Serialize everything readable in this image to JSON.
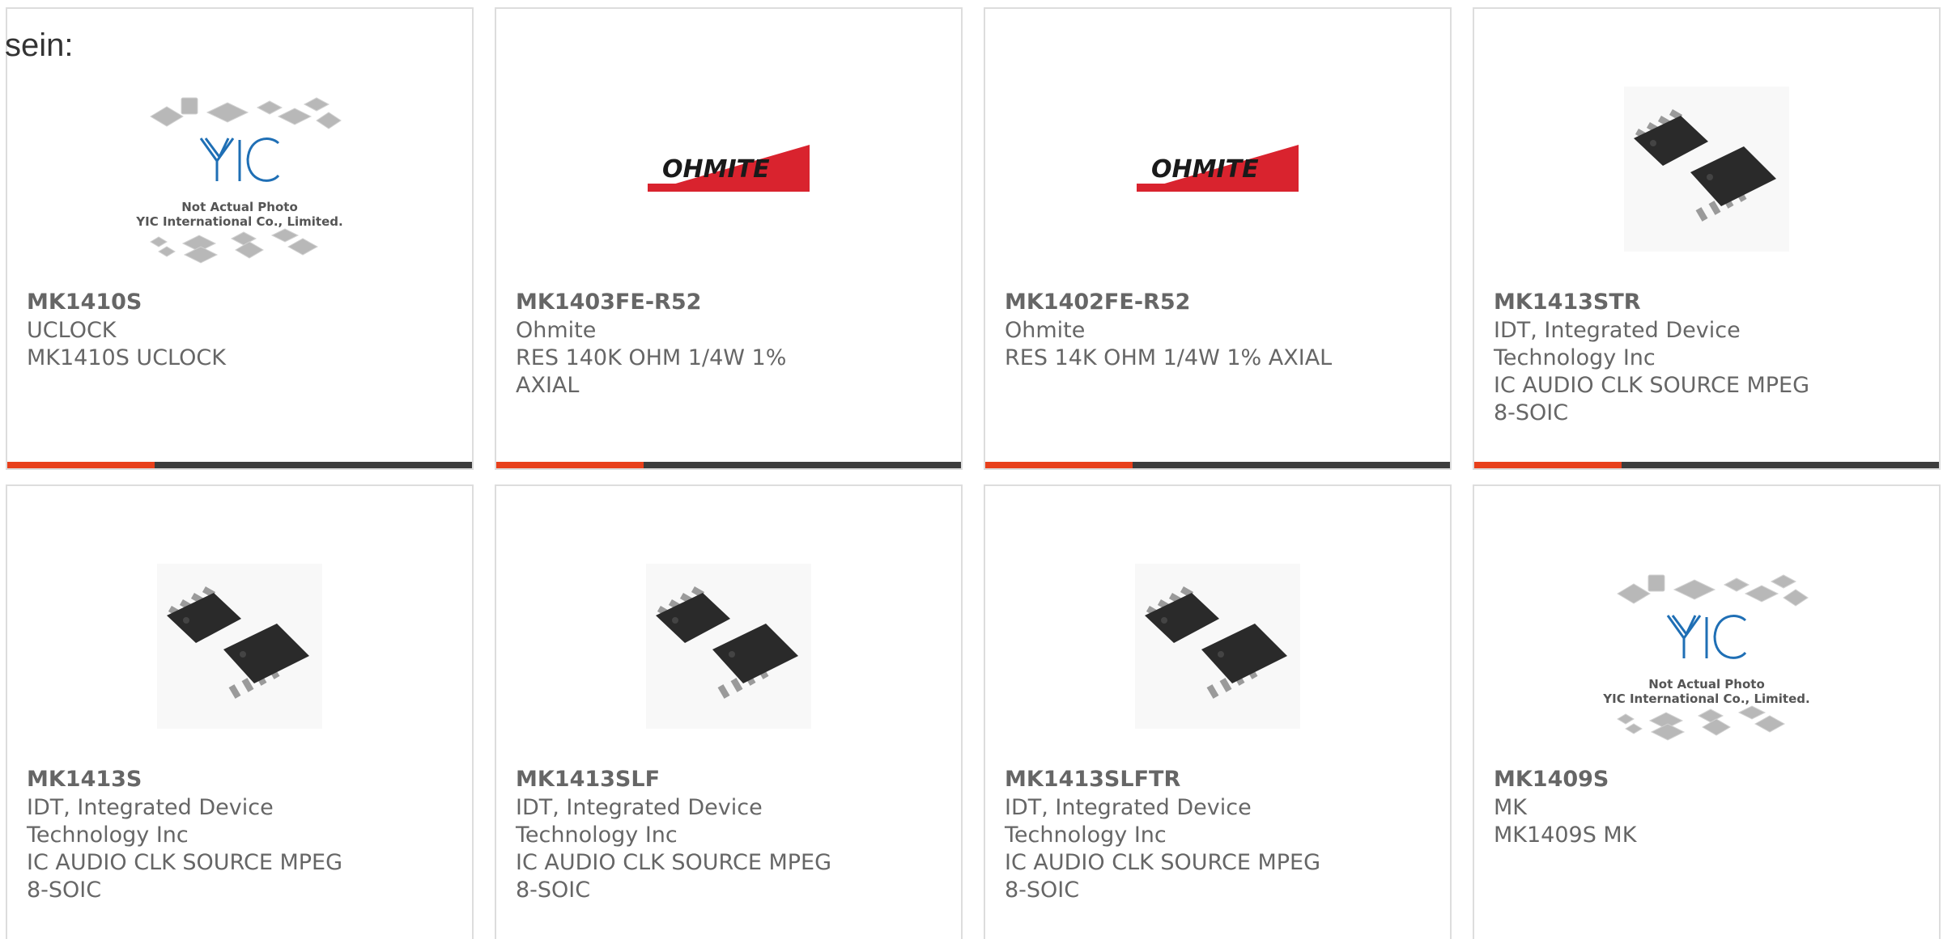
{
  "lead_text": "sein:",
  "cards": [
    {
      "part": "MK1410S",
      "maker": "UCLOCK",
      "description": "MK1410S UCLOCK",
      "image": "yic-placeholder",
      "placeholder_caption_1": "Not Actual Photo",
      "placeholder_caption_2": "YIC International Co., Limited.",
      "logo_text": "YIC"
    },
    {
      "part": "MK1403FE-R52",
      "maker": "Ohmite",
      "description": "RES 140K OHM 1/4W 1% AXIAL",
      "image": "ohmite-logo",
      "logo_text": "OHMITE"
    },
    {
      "part": "MK1402FE-R52",
      "maker": "Ohmite",
      "description": "RES 14K OHM 1/4W 1% AXIAL",
      "image": "ohmite-logo",
      "logo_text": "OHMITE"
    },
    {
      "part": "MK1413STR",
      "maker": "IDT, Integrated Device Technology Inc",
      "description": "IC AUDIO CLK SOURCE MPEG 8-SOIC",
      "image": "soic-chips"
    },
    {
      "part": "MK1413S",
      "maker": "IDT, Integrated Device Technology Inc",
      "description": "IC AUDIO CLK SOURCE MPEG 8-SOIC",
      "image": "soic-chips"
    },
    {
      "part": "MK1413SLF",
      "maker": "IDT, Integrated Device Technology Inc",
      "description": "IC AUDIO CLK SOURCE MPEG 8-SOIC",
      "image": "soic-chips"
    },
    {
      "part": "MK1413SLFTR",
      "maker": "IDT, Integrated Device Technology Inc",
      "description": "IC AUDIO CLK SOURCE MPEG 8-SOIC",
      "image": "soic-chips"
    },
    {
      "part": "MK1409S",
      "maker": "MK",
      "description": "MK1409S MK",
      "image": "yic-placeholder",
      "placeholder_caption_1": "Not Actual Photo",
      "placeholder_caption_2": "YIC International Co., Limited.",
      "logo_text": "YIC"
    }
  ],
  "colors": {
    "accent": "#e8401c",
    "bar": "#3c3c3c",
    "ohmite_red": "#d9232e",
    "yic_blue": "#1f6fb5",
    "text": "#666666",
    "border": "#dddddd"
  }
}
